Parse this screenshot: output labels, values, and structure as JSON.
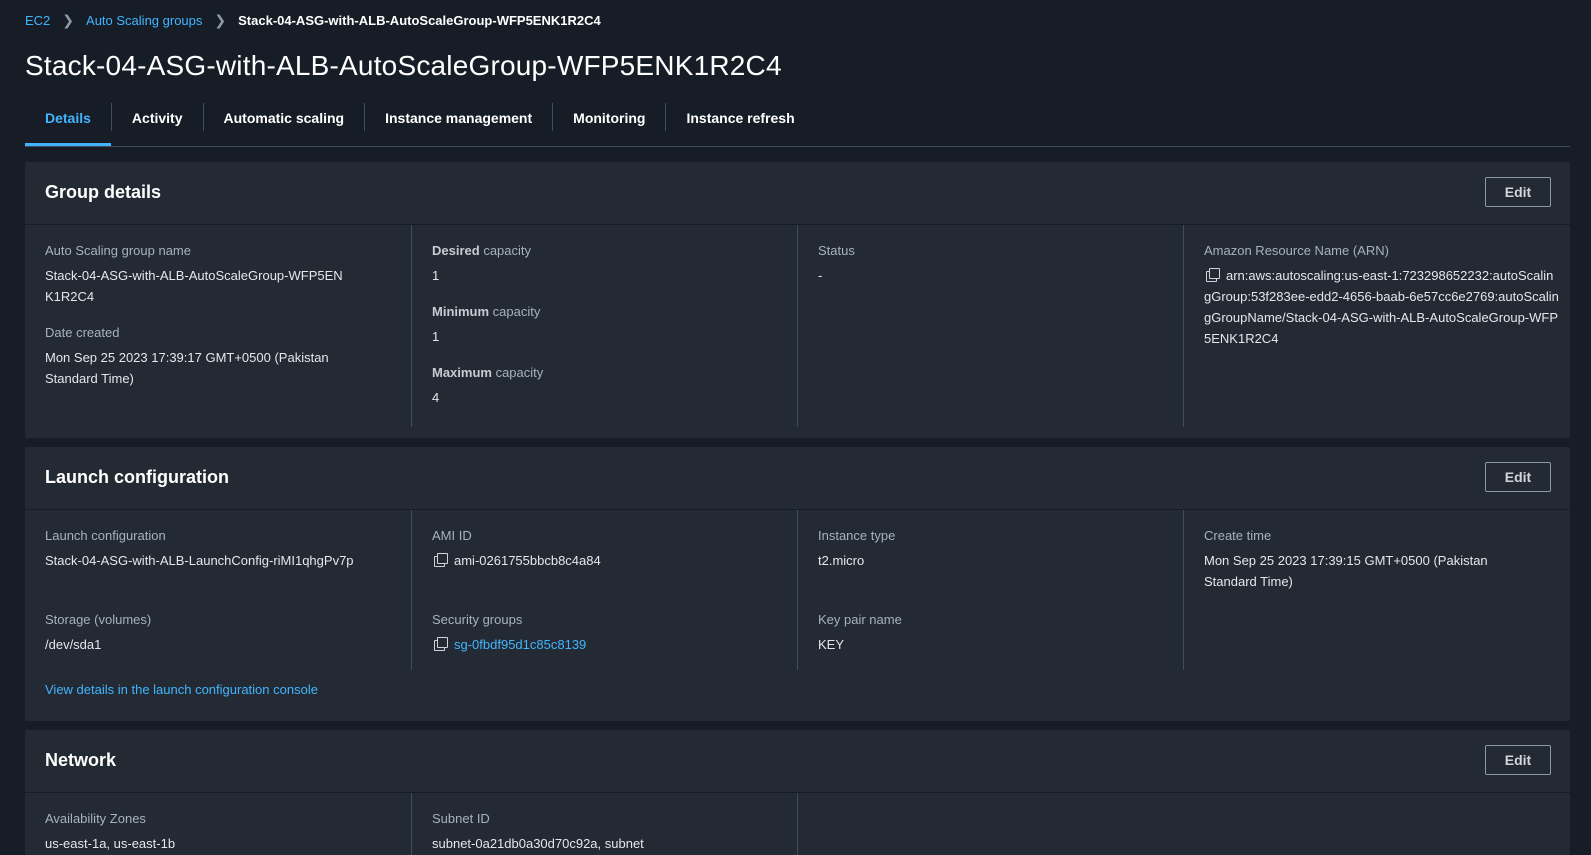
{
  "breadcrumb": {
    "ec2": "EC2",
    "asg": "Auto Scaling groups",
    "current": "Stack-04-ASG-with-ALB-AutoScaleGroup-WFP5ENK1R2C4"
  },
  "title": "Stack-04-ASG-with-ALB-AutoScaleGroup-WFP5ENK1R2C4",
  "tabs": [
    "Details",
    "Activity",
    "Automatic scaling",
    "Instance management",
    "Monitoring",
    "Instance refresh"
  ],
  "group_details": {
    "title": "Group details",
    "edit": "Edit",
    "asg_name_label": "Auto Scaling group name",
    "asg_name": "Stack-04-ASG-with-ALB-AutoScaleGroup-WFP5ENK1R2C4",
    "date_created_label": "Date created",
    "date_created": "Mon Sep 25 2023 17:39:17 GMT+0500 (Pakistan Standard Time)",
    "desired_bold": "Desired",
    "desired_label": " capacity",
    "desired": "1",
    "minimum_bold": "Minimum",
    "minimum_label": " capacity",
    "minimum": "1",
    "maximum_bold": "Maximum",
    "maximum_label": " capacity",
    "maximum": "4",
    "status_label": "Status",
    "status": "-",
    "arn_label": "Amazon Resource Name (ARN)",
    "arn": "arn:aws:autoscaling:us-east-1:723298652232:autoScalingGroup:53f283ee-edd2-4656-baab-6e57cc6e2769:autoScalingGroupName/Stack-04-ASG-with-ALB-AutoScaleGroup-WFP5ENK1R2C4"
  },
  "launch_configuration": {
    "title": "Launch configuration",
    "edit": "Edit",
    "lc_label": "Launch configuration",
    "lc": "Stack-04-ASG-with-ALB-LaunchConfig-riMI1qhgPv7p",
    "storage_label": "Storage (volumes)",
    "storage": "/dev/sda1",
    "ami_label": "AMI ID",
    "ami": "ami-0261755bbcb8c4a84",
    "sg_label": "Security groups",
    "sg": "sg-0fbdf95d1c85c8139",
    "instance_type_label": "Instance type",
    "instance_type": "t2.micro",
    "key_pair_label": "Key pair name",
    "key_pair": "KEY",
    "create_time_label": "Create time",
    "create_time": "Mon Sep 25 2023 17:39:15 GMT+0500 (Pakistan Standard Time)",
    "view_link": "View details in the launch configuration console"
  },
  "network": {
    "title": "Network",
    "edit": "Edit",
    "az_label": "Availability Zones",
    "az": "us-east-1a, us-east-1b",
    "subnet_label": "Subnet ID",
    "subnet": "subnet-0a21db0a30d70c92a, subnet"
  }
}
